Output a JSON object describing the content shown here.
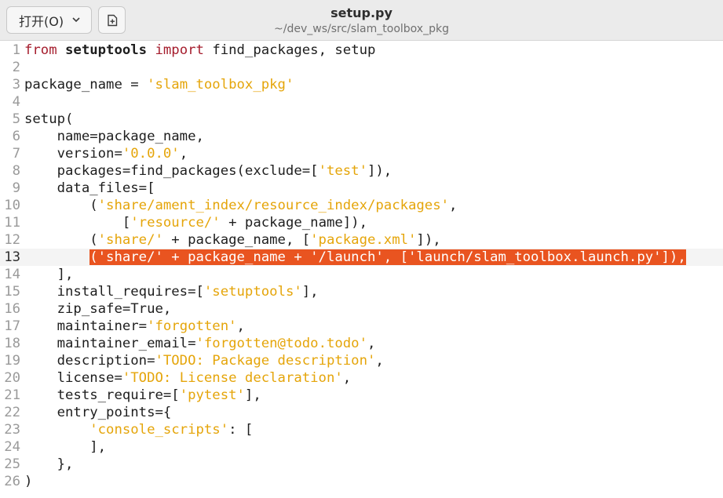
{
  "toolbar": {
    "open_label": "打开(O)",
    "open_icon": "chevron-down-icon",
    "new_tab_icon": "new-document-icon"
  },
  "header": {
    "title": "setup.py",
    "subtitle": "~/dev_ws/src/slam_toolbox_pkg"
  },
  "colors": {
    "keyword": "#a51d2d",
    "string": "#e5a50a",
    "selection": "#e95420"
  },
  "editor": {
    "current_line": 13,
    "lines": [
      {
        "n": "1",
        "segs": [
          [
            "kw",
            "from"
          ],
          [
            "t",
            " "
          ],
          [
            "mod",
            "setuptools"
          ],
          [
            "t",
            " "
          ],
          [
            "kw",
            "import"
          ],
          [
            "t",
            " find_packages, setup"
          ]
        ]
      },
      {
        "n": "2",
        "segs": []
      },
      {
        "n": "3",
        "segs": [
          [
            "t",
            "package_name = "
          ],
          [
            "str",
            "'slam_toolbox_pkg'"
          ]
        ]
      },
      {
        "n": "4",
        "segs": []
      },
      {
        "n": "5",
        "segs": [
          [
            "t",
            "setup("
          ]
        ]
      },
      {
        "n": "6",
        "segs": [
          [
            "t",
            "    name=package_name,"
          ]
        ]
      },
      {
        "n": "7",
        "segs": [
          [
            "t",
            "    version="
          ],
          [
            "str",
            "'0.0.0'"
          ],
          [
            "t",
            ","
          ]
        ]
      },
      {
        "n": "8",
        "segs": [
          [
            "t",
            "    packages=find_packages(exclude=["
          ],
          [
            "str",
            "'test'"
          ],
          [
            "t",
            "]),"
          ]
        ]
      },
      {
        "n": "9",
        "segs": [
          [
            "t",
            "    data_files=["
          ]
        ]
      },
      {
        "n": "10",
        "segs": [
          [
            "t",
            "        ("
          ],
          [
            "str",
            "'share/ament_index/resource_index/packages'"
          ],
          [
            "t",
            ","
          ]
        ]
      },
      {
        "n": "11",
        "segs": [
          [
            "t",
            "            ["
          ],
          [
            "str",
            "'resource/'"
          ],
          [
            "t",
            " + package_name]),"
          ]
        ]
      },
      {
        "n": "12",
        "segs": [
          [
            "t",
            "        ("
          ],
          [
            "str",
            "'share/'"
          ],
          [
            "t",
            " + package_name, ["
          ],
          [
            "str",
            "'package.xml'"
          ],
          [
            "t",
            "]),"
          ]
        ]
      },
      {
        "n": "13",
        "segs": [
          [
            "t",
            "        "
          ],
          [
            "sel",
            "('share/' + package_name + '/launch', ['launch/slam_toolbox.launch.py']),"
          ]
        ]
      },
      {
        "n": "14",
        "segs": [
          [
            "t",
            "    ],"
          ]
        ]
      },
      {
        "n": "15",
        "segs": [
          [
            "t",
            "    install_requires=["
          ],
          [
            "str",
            "'setuptools'"
          ],
          [
            "t",
            "],"
          ]
        ]
      },
      {
        "n": "16",
        "segs": [
          [
            "t",
            "    zip_safe=True,"
          ]
        ]
      },
      {
        "n": "17",
        "segs": [
          [
            "t",
            "    maintainer="
          ],
          [
            "str",
            "'forgotten'"
          ],
          [
            "t",
            ","
          ]
        ]
      },
      {
        "n": "18",
        "segs": [
          [
            "t",
            "    maintainer_email="
          ],
          [
            "str",
            "'forgotten@todo.todo'"
          ],
          [
            "t",
            ","
          ]
        ]
      },
      {
        "n": "19",
        "segs": [
          [
            "t",
            "    description="
          ],
          [
            "str",
            "'TODO: Package description'"
          ],
          [
            "t",
            ","
          ]
        ]
      },
      {
        "n": "20",
        "segs": [
          [
            "t",
            "    license="
          ],
          [
            "str",
            "'TODO: License declaration'"
          ],
          [
            "t",
            ","
          ]
        ]
      },
      {
        "n": "21",
        "segs": [
          [
            "t",
            "    tests_require=["
          ],
          [
            "str",
            "'pytest'"
          ],
          [
            "t",
            "],"
          ]
        ]
      },
      {
        "n": "22",
        "segs": [
          [
            "t",
            "    entry_points={"
          ]
        ]
      },
      {
        "n": "23",
        "segs": [
          [
            "t",
            "        "
          ],
          [
            "str",
            "'console_scripts'"
          ],
          [
            "t",
            ": ["
          ]
        ]
      },
      {
        "n": "24",
        "segs": [
          [
            "t",
            "        ],"
          ]
        ]
      },
      {
        "n": "25",
        "segs": [
          [
            "t",
            "    },"
          ]
        ]
      },
      {
        "n": "26",
        "segs": [
          [
            "t",
            ")"
          ]
        ]
      }
    ]
  }
}
